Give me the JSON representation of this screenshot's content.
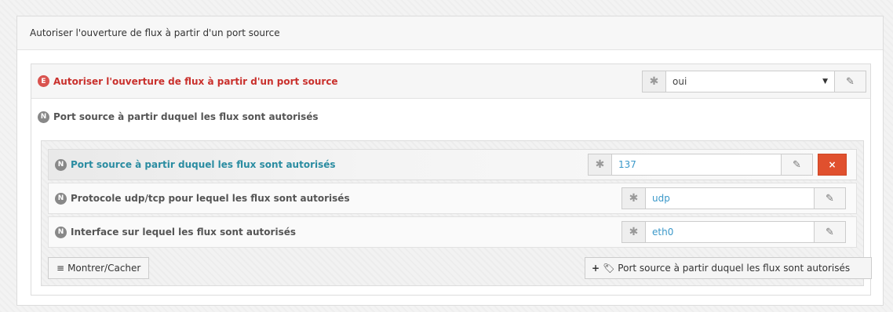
{
  "panel": {
    "title": "Autoriser l'ouverture de flux à partir d'un port source"
  },
  "master": {
    "badge": "E",
    "label": "Autoriser l'ouverture de flux à partir d'un port source",
    "required_mark": "✱",
    "value": "oui"
  },
  "section": {
    "badge": "N",
    "label": "Port source à partir duquel les flux sont autorisés"
  },
  "rows": [
    {
      "badge": "N",
      "label": "Port source à partir duquel les flux sont autorisés",
      "value": "137",
      "required_mark": "✱"
    },
    {
      "badge": "N",
      "label": "Protocole udp/tcp pour lequel les flux sont autorisés",
      "value": "udp",
      "required_mark": "✱"
    },
    {
      "badge": "N",
      "label": "Interface sur lequel les flux sont autorisés",
      "value": "eth0",
      "required_mark": "✱"
    }
  ],
  "actions": {
    "toggle_label": "Montrer/Cacher",
    "add_label": "Port source à partir duquel les flux sont autorisés",
    "delete_label": "×"
  },
  "icons": {
    "edit": "pencil-square-icon",
    "toggle": "bars-icon",
    "add": "plus-icon",
    "tag": "tag-icon"
  },
  "colors": {
    "danger": "#e0502e",
    "required_label": "#c9302c",
    "link": "#2a8ca1",
    "value": "#3a98c9"
  }
}
